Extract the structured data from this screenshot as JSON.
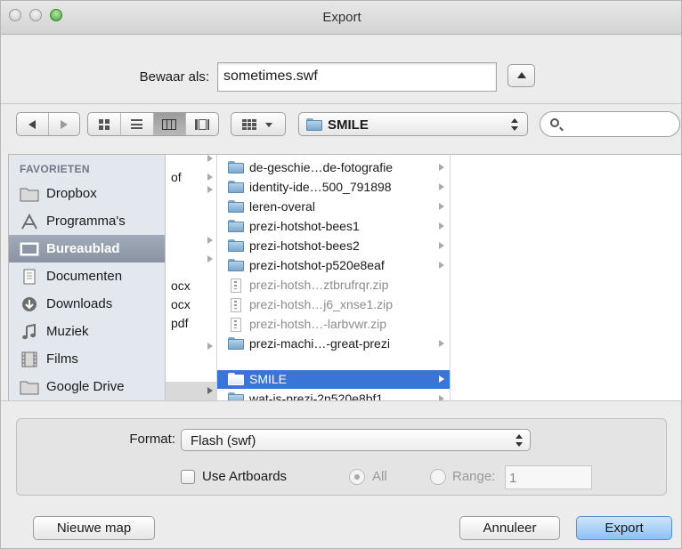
{
  "window": {
    "title": "Export"
  },
  "save_as": {
    "label": "Bewaar als:",
    "filename": "sometimes.swf"
  },
  "toolbar": {
    "path_folder": "SMILE",
    "search_value": ""
  },
  "sidebar": {
    "header": "FAVORIETEN",
    "items": [
      {
        "label": "Dropbox",
        "icon": "folder-icon",
        "selected": false
      },
      {
        "label": "Programma's",
        "icon": "applications-icon",
        "selected": false
      },
      {
        "label": "Bureaublad",
        "icon": "desktop-icon",
        "selected": true
      },
      {
        "label": "Documenten",
        "icon": "documents-icon",
        "selected": false
      },
      {
        "label": "Downloads",
        "icon": "downloads-icon",
        "selected": false
      },
      {
        "label": "Muziek",
        "icon": "music-icon",
        "selected": false
      },
      {
        "label": "Films",
        "icon": "film-icon",
        "selected": false
      },
      {
        "label": "Google Drive",
        "icon": "folder-icon",
        "selected": false
      }
    ]
  },
  "column1": {
    "items": [
      {
        "label": "of",
        "arrow": true
      },
      {
        "label": "",
        "arrow": true
      },
      {
        "label": "ocx",
        "arrow": false
      },
      {
        "label": "ocx",
        "arrow": false
      },
      {
        "label": "pdf",
        "arrow": false
      }
    ]
  },
  "column2": {
    "items": [
      {
        "label": "de-geschie…de-fotografie",
        "type": "folder",
        "arrow": true
      },
      {
        "label": "identity-ide…500_791898",
        "type": "folder",
        "arrow": true
      },
      {
        "label": "leren-overal",
        "type": "folder",
        "arrow": true
      },
      {
        "label": "prezi-hotshot-bees1",
        "type": "folder",
        "arrow": true
      },
      {
        "label": "prezi-hotshot-bees2",
        "type": "folder",
        "arrow": true
      },
      {
        "label": "prezi-hotshot-p520e8eaf",
        "type": "folder",
        "arrow": true
      },
      {
        "label": "prezi-hotsh…ztbrufrqr.zip",
        "type": "zip",
        "arrow": false
      },
      {
        "label": "prezi-hotsh…j6_xnse1.zip",
        "type": "zip",
        "arrow": false
      },
      {
        "label": "prezi-hotsh…-larbvwr.zip",
        "type": "zip",
        "arrow": false
      },
      {
        "label": "prezi-machi…-great-prezi",
        "type": "folder",
        "arrow": true
      },
      {
        "label": "SMILE",
        "type": "folder",
        "arrow": true,
        "selected": true
      },
      {
        "label": "wat-is-prezi-2n520e8bf1",
        "type": "folder",
        "arrow": true
      }
    ]
  },
  "options": {
    "format_label": "Format:",
    "format_value": "Flash (swf)",
    "use_artboards_label": "Use Artboards",
    "use_artboards_checked": false,
    "all_label": "All",
    "range_label": "Range:",
    "range_value": "1"
  },
  "buttons": {
    "new_folder": "Nieuwe map",
    "cancel": "Annuleer",
    "export": "Export"
  },
  "colors": {
    "selection": "#3875d7",
    "sidebar_bg": "#e3e7ee",
    "default_button": "#8cc0f3"
  }
}
